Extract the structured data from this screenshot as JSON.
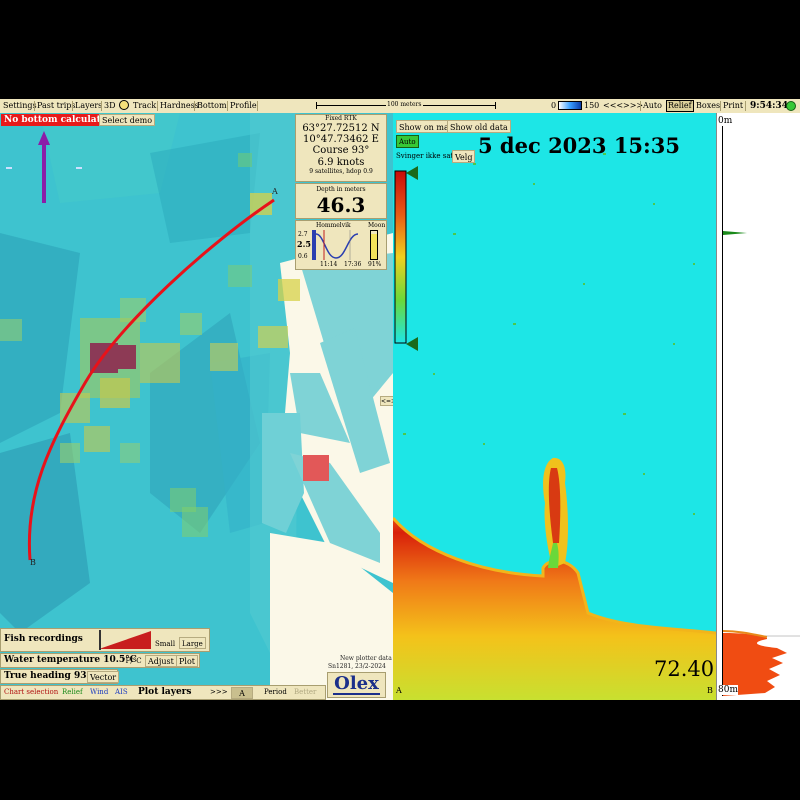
{
  "toolbar": {
    "items": [
      "Settings",
      "Past trips",
      "Layers",
      "3D",
      "Track",
      "Hardness",
      "Bottom",
      "Profile"
    ],
    "scale_label": "100 meters",
    "depth_scale_min": "0",
    "depth_scale_max": "150",
    "nav_back": "<<<",
    "nav_fwd": ">>>",
    "right_items": [
      "Auto",
      "Relief",
      "Boxes",
      "Print"
    ],
    "clock": "9:54:34"
  },
  "map": {
    "warning": "No bottom calculation",
    "select_demo": "Select demo",
    "point_a": "A",
    "point_b": "B",
    "center_toggle": "<=>"
  },
  "gps": {
    "source": "Fixed RTK",
    "lat": "63°27.72512 N",
    "lon": "10°47.73462 E",
    "course": "Course 93°",
    "speed": "6.9 knots",
    "sats": "9 satellites, hdop 0.9"
  },
  "depth": {
    "label": "Depth in meters",
    "value": "46.3"
  },
  "tide": {
    "location": "Hommelvik",
    "moon_label": "Moon",
    "max": "2.7",
    "current": "2.5",
    "min": "0.6",
    "time1": "11:14",
    "time2": "17:36",
    "moon_pct": "91%"
  },
  "bottom_panel": {
    "fish_recordings": "Fish recordings",
    "small": "Small",
    "large": "Large",
    "water_temp": "Water temperature 10.5°C",
    "unit_toggle": "°F/°C",
    "adjust": "Adjust",
    "plot": "Plot",
    "true_heading": "True heading 93.0°",
    "vector": "Vector",
    "tabs": [
      "Chart selection",
      "Relief",
      "Wind",
      "AIS"
    ],
    "plot_layers": "Plot layers",
    "layer_nav": ">>>",
    "layer_a": "A",
    "period": "Period",
    "better": "Better",
    "plotter_note_1": "New plotter data",
    "plotter_note_2": "Sn1281, 23/2-2024",
    "logo": "Olex"
  },
  "echo": {
    "show_on_map": "Show on map",
    "show_old_data": "Show old data",
    "auto": "Auto",
    "transducer": "Svinger ikke satt",
    "choose": "Velg",
    "date": "5 dec 2023 15:35",
    "depth_reading": "72.40",
    "corner_a": "A",
    "corner_b": "B",
    "top_depth": "0m",
    "bottom_depth": "80m"
  },
  "colors": {
    "toolbar_bg": "#efe6bd",
    "map_water": "#3ec3cf",
    "echo_bg": "#1de6e6",
    "track": "#e8121a",
    "warning_bg": "#e81a1a"
  }
}
